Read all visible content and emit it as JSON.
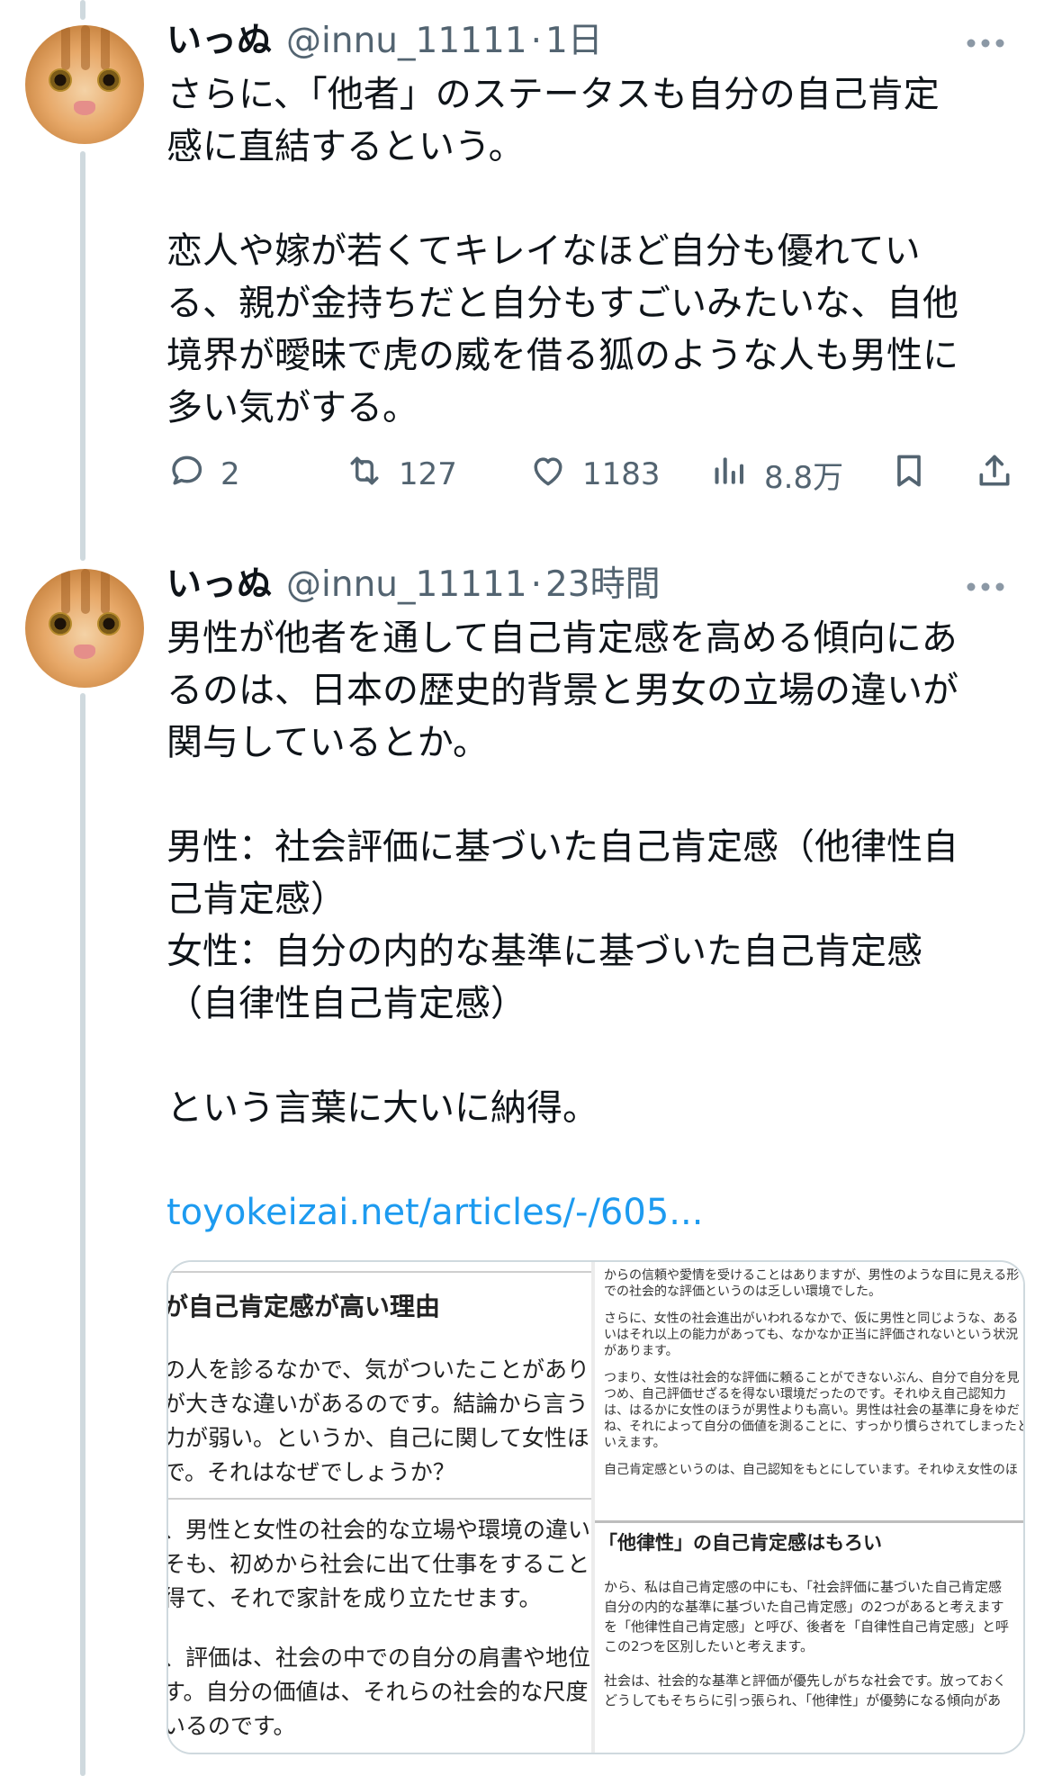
{
  "tweets": [
    {
      "name": "いっぬ",
      "handle": "@innu_11111",
      "separator": "·",
      "time": "1日",
      "text": "さらに、「他者」のステータスも自分の自己肯定\n感に直結するという。\n\n恋人や嫁が若くてキレイなほど自分も優れてい\nる、親が金持ちだと自分もすごいみたいな、自他\n境界が曖昧で虎の威を借る狐のような人も男性に\n多い気がする。",
      "actions": {
        "replies": "2",
        "retweets": "127",
        "likes": "1183",
        "views": "8.8万"
      }
    },
    {
      "name": "いっぬ",
      "handle": "@innu_11111",
      "separator": "·",
      "time": "23時間",
      "text": "男性が他者を通して自己肯定感を高める傾向にあ\nるのは、日本の歴史的背景と男女の立場の違いが\n関与しているとか。\n\n男性：社会評価に基づいた自己肯定感（他律性自\n己肯定感）\n女性：自分の内的な基準に基づいた自己肯定感\n（自律性自己肯定感）\n\nという言葉に大いに納得。",
      "link": "toyokeizai.net/articles/-/605...",
      "card": {
        "left_heading": "が自己肯定感が高い理由",
        "left_lines": [
          "の人を診るなかで、気がついたことがあります",
          "が大きな違いがあるのです。結論から言うと",
          "力が弱い。というか、自己に関して女性ほど",
          "で。それはなぜでしょうか？",
          "、男性と女性の社会的な立場や環境の違いが",
          "そも、初めから社会に出て仕事をすること",
          "得て、それで家計を成り立たせます。",
          "、評価は、社会の中での自分の肩書や地位",
          "す。自分の価値は、それらの社会的な尺度",
          "いるのです。"
        ],
        "right_lines": [
          "からの信頼や愛情を受けることはありますが、男性のような目に見える形",
          "での社会的な評価というのは乏しい環境でした。",
          "さらに、女性の社会進出がいわれるなかで、仮に男性と同じような、ある",
          "いはそれ以上の能力があっても、なかなか正当に評価されないという状況",
          "があります。",
          "つまり、女性は社会的な評価に頼ることができないぶん、自分で自分を見",
          "つめ、自己評価せざるを得ない環境だったのです。それゆえ自己認知力",
          "は、はるかに女性のほうが男性よりも高い。男性は社会の基準に身をゆだ",
          "ね、それによって自分の価値を測ることに、すっかり慣らされてしまったと",
          "いえます。",
          "自己肯定感というのは、自己認知をもとにしています。それゆえ女性のほ"
        ],
        "right_heading": "「他律性」の自己肯定感はもろい",
        "right_lines_2": [
          "から、私は自己肯定感の中にも、「社会評価に基づいた自己肯定感",
          "自分の内的な基準に基づいた自己肯定感」の2つがあると考えます",
          "を「他律性自己肯定感」と呼び、後者を「自律性自己肯定感」と呼",
          "この2つを区別したいと考えます。",
          "社会は、社会的な基準と評価が優先しがちな社会です。放っておく",
          "どうしてもそちらに引っ張られ、「他律性」が優勢になる傾向があ"
        ]
      }
    }
  ],
  "icons": {
    "reply": "reply-icon",
    "retweet": "retweet-icon",
    "like": "heart-icon",
    "views": "views-icon",
    "bookmark": "bookmark-icon",
    "share": "share-icon",
    "more": "more-icon"
  },
  "colors": {
    "text": "#0f1419",
    "secondary": "#536471",
    "link": "#1d9bf0",
    "thread_line": "#cfd9de"
  }
}
